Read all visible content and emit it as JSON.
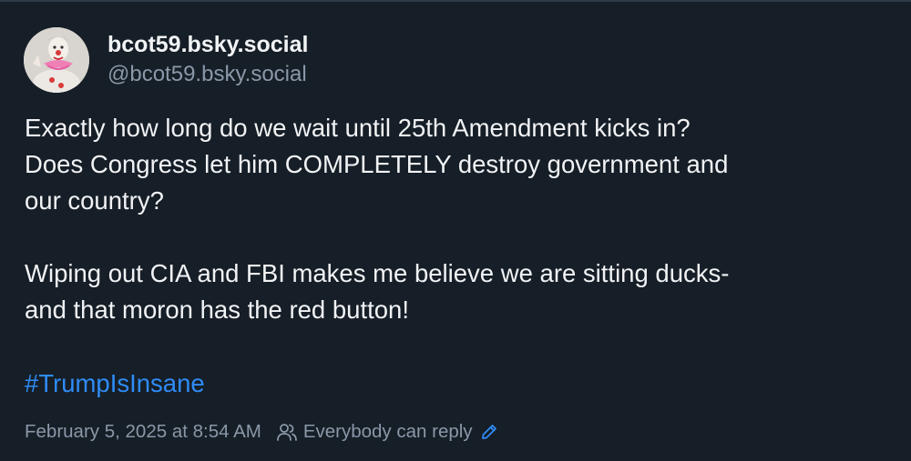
{
  "post": {
    "display_name": "bcot59.bsky.social",
    "handle": "@bcot59.bsky.social",
    "avatar_icon": "clown-avatar",
    "text_lines": [
      "Exactly how long do we wait until 25th Amendment kicks in?",
      "Does Congress let him COMPLETELY destroy government and",
      "our country?",
      "Wiping out CIA and FBI makes me believe we are sitting ducks-",
      "and that moron has the red button!"
    ],
    "hashtag": "#TrumpIsInsane",
    "timestamp": "February 5, 2025 at 8:54 AM",
    "reply_setting": "Everybody can reply",
    "reply_icon": "people-icon",
    "edit_icon": "pencil-icon"
  },
  "colors": {
    "background": "#161e27",
    "text": "#f1f3f5",
    "muted": "#8a98a8",
    "link": "#2f8cf6"
  }
}
